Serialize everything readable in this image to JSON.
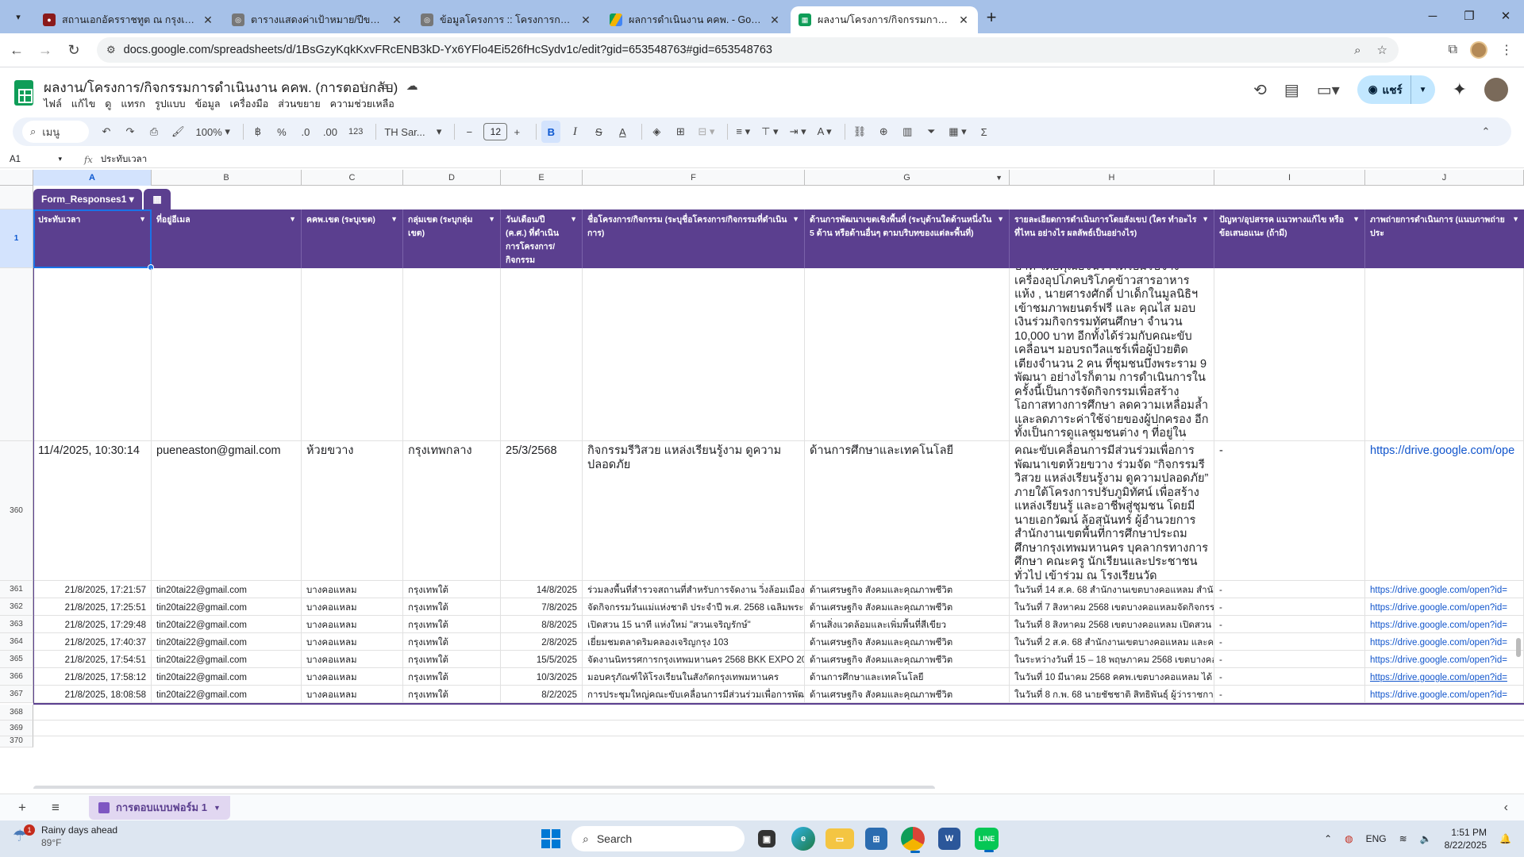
{
  "browser": {
    "tabs": [
      {
        "title": "สถานเอกอัครราชทูต ณ กรุงเบอร์ลิน",
        "icon_color": "#8b1a1a",
        "active": false
      },
      {
        "title": "ตารางแสดงค่าเป้าหมาย/ปีของ KEY_R",
        "icon_color": "#666666",
        "active": false
      },
      {
        "title": "ข้อมูลโครงการ :: โครงการการมีส่วนร่",
        "icon_color": "#666666",
        "active": false
      },
      {
        "title": "ผลการดำเนินงาน คคพ. - Google ไ",
        "icon_color": "#f4b400",
        "active": false
      },
      {
        "title": "ผลงาน/โครงการ/กิจกรรมการดำเนินง",
        "icon_color": "#0f9d58",
        "active": true
      }
    ],
    "url": "docs.google.com/spreadsheets/d/1BsGzyKqkKxvFRcENB3kD-Yx6YFlo4Ei526fHcSydv1c/edit?gid=653548763#gid=653548763"
  },
  "sheets": {
    "doc_title": "ผลงาน/โครงการ/กิจกรรมการดำเนินงาน คคพ. (การตอบกลับ)",
    "menu": [
      "ไฟล์",
      "แก้ไข",
      "ดู",
      "แทรก",
      "รูปแบบ",
      "ข้อมูล",
      "เครื่องมือ",
      "ส่วนขยาย",
      "ความช่วยเหลือ"
    ],
    "share_label": "แชร์",
    "toolbar": {
      "search_menu": "เมนู",
      "zoom": "100%",
      "currency": "฿",
      "percent": "%",
      "dec_dec": ".0",
      "dec_inc": ".00",
      "format_123": "123",
      "font": "TH Sar...",
      "font_size": "12"
    },
    "name_box": "A1",
    "formula": "ประทับเวลา",
    "columns": [
      "A",
      "B",
      "C",
      "D",
      "E",
      "F",
      "G",
      "H",
      "I",
      "J"
    ],
    "table_name": "Form_Responses1",
    "header_row_num": "1",
    "headers": [
      "ประทับเวลา",
      "ที่อยู่อีเมล",
      "คคพ.เขต (ระบุเขต)",
      "กลุ่มเขต (ระบุกลุ่มเขต)",
      "วัน/เดือน/ปี (ค.ศ.) ที่ดำเนินการโครงการ/กิจกรรม",
      "ชื่อโครงการ/กิจกรรม (ระบุชื่อโครงการ/กิจกรรมที่ดำเนินการ)",
      "ด้านการพัฒนาเขตเชิงพื้นที่ (ระบุด้านใดด้านหนึ่งใน 5 ด้าน หรือด้านอื่นๆ ตามบริบทของแต่ละพื้นที่)",
      "รายละเอียดการดำเนินการโดยสังเขป (ใคร ทำอะไร ที่ไหน อย่างไร ผลลัพธ์เป็นอย่างไร)",
      "ปัญหา/อุปสรรค แนวทางแก้ไข หรือข้อเสนอแนะ (ถ้ามี)",
      "ภาพถ่ายการดำเนินการ (แนบภาพถ่ายประ"
    ],
    "overflow_text": "บาท โดยคุณอัจฉรา เตรียมรับจ้างเครื่องอุปโภคบริโภคข้าวสารอาหารแห้ง , นายศารงศักดิ์ ปาเด็กในมูลนิธิฯเข้าชมภาพยนตร์ฟรี และ คุณไส มอบเงินร่วมกิจกรรมทัศนศึกษา จำนวน 10,000 บาท อีกทั้งได้ร่วมกับคณะขับเคลื่อนฯ มอบรถวีลแชร์เพื่อผู้ป่วยติดเตียงจำนวน 2 คน ที่ชุมชนบึงพระราม 9 พัฒนา อย่างไรก็ตาม การดำเนินการในครั้งนี้เป็นการจัดกิจกรรมเพื่อสร้างโอกาสทางการศึกษา ลดความเหลื่อมล้ำและลดภาระค่าใช้จ่ายของผู้ปกครอง อีกทั้งเป็นการดูแลชุมชนต่าง ๆ ที่อยู่ในบันทึกข้อตกลงที่จะร่วมกันพัฒนาเด็กและเยาวชนกับโรงเรียนวัดอุทัยธาราม",
    "row_360": {
      "num": "360",
      "cells": [
        "11/4/2025, 10:30:14",
        "pueneaston@gmail.com",
        "ห้วยขวาง",
        "กรุงเทพกลาง",
        "25/3/2568",
        "กิจกรรมรีวิสวย แหล่งเรียนรู้งาม ดูความปลอดภัย",
        "ด้านการศึกษาและเทคโนโลยี",
        "คณะขับเคลื่อนการมีส่วนร่วมเพื่อการพัฒนาเขตห้วยขวาง ร่วมจัด “กิจกรรมรีวิสวย แหล่งเรียนรู้งาม ดูความปลอดภัย” ภายใต้โครงการปรับภูมิทัศน์ เพื่อสร้างแหล่งเรียนรู้ และอาชีพสู่ชุมชน โดยมีนายเอกวัฒน์ ล้อสุนันทร์ ผู้อำนวยการสำนักงานเขตพื้นที่การศึกษาประถมศึกษากรุงเทพมหานคร บุคลากรทางการศึกษา คณะครู นักเรียนและประชาชนทั่วไป เข้าร่วม ณ โรงเรียนวัดอุทัยธาราม",
        "-",
        "https://drive.google.com/ope"
      ]
    },
    "rows": [
      {
        "num": "361",
        "cells": [
          "21/8/2025, 17:21:57",
          "tin20tai22@gmail.com",
          "บางคอแหลม",
          "กรุงเทพใต้",
          "14/8/2025",
          "ร่วมลงพื้นที่สำรวจสถานที่สำหรับการจัดงาน   วิ่งล้อมเมือง",
          "ด้านเศรษฐกิจ สังคมและคุณภาพชีวิต",
          "ในวันที่ 14 ส.ค. 68 สำนักงานเขตบางคอแหลม สำนัก",
          "-",
          "https://drive.google.com/open?id="
        ]
      },
      {
        "num": "362",
        "cells": [
          "21/8/2025, 17:25:51",
          "tin20tai22@gmail.com",
          "บางคอแหลม",
          "กรุงเทพใต้",
          "7/8/2025",
          "จัดกิจกรรมวันแม่แห่งชาติ ประจำปี พ.ศ. 2568 เฉลิมพระเกียรติ",
          "ด้านเศรษฐกิจ สังคมและคุณภาพชีวิต",
          "ในวันที่ 7 สิงหาคม 2568 เขตบางคอแหลมจัดกิจกรรม",
          "-",
          "https://drive.google.com/open?id="
        ]
      },
      {
        "num": "363",
        "cells": [
          "21/8/2025, 17:29:48",
          "tin20tai22@gmail.com",
          "บางคอแหลม",
          "กรุงเทพใต้",
          "8/8/2025",
          "เปิดสวน 15 นาที แห่งใหม่ \"สวนเจริญรักษ์\"",
          "ด้านสิ่งแวดล้อมและเพิ่มพื้นที่สีเขียว",
          "ในวันที่ 8 สิงหาคม 2568 เขตบางคอแหลม เปิดสวน",
          "-",
          "https://drive.google.com/open?id="
        ]
      },
      {
        "num": "364",
        "cells": [
          "21/8/2025, 17:40:37",
          "tin20tai22@gmail.com",
          "บางคอแหลม",
          "กรุงเทพใต้",
          "2/8/2025",
          "เยี่ยมชมตลาดริมคลองเจริญกรุง 103",
          "ด้านเศรษฐกิจ สังคมและคุณภาพชีวิต",
          "ในวันที่ 2 ส.ค. 68 สำนักงานเขตบางคอแหลม และคณะ",
          "-",
          "https://drive.google.com/open?id="
        ]
      },
      {
        "num": "365",
        "cells": [
          "21/8/2025, 17:54:51",
          "tin20tai22@gmail.com",
          "บางคอแหลม",
          "กรุงเทพใต้",
          "15/5/2025",
          "จัดงานนิทรรศการกรุงเทพมหานคร 2568 BKK EXPO 2025",
          "ด้านเศรษฐกิจ สังคมและคุณภาพชีวิต",
          "ในระหว่างวันที่ 15 – 18 พฤษภาคม 2568 เขตบางคอแหลม",
          "-",
          "https://drive.google.com/open?id="
        ]
      },
      {
        "num": "366",
        "cells": [
          "21/8/2025, 17:58:12",
          "tin20tai22@gmail.com",
          "บางคอแหลม",
          "กรุงเทพใต้",
          "10/3/2025",
          "มอบครุภัณฑ์ให้โรงเรียนในสังกัดกรุงเทพมหานคร",
          "ด้านการศึกษาและเทคโนโลยี",
          "ในวันที่ 10 มีนาคม 2568  คคพ.เขตบางคอแหลม ได้",
          "-",
          "https://drive.google.com/open?id="
        ]
      },
      {
        "num": "367",
        "cells": [
          "21/8/2025, 18:08:58",
          "tin20tai22@gmail.com",
          "บางคอแหลม",
          "กรุงเทพใต้",
          "8/2/2025",
          "การประชุมใหญ่คณะขับเคลื่อนการมีส่วนร่วมเพื่อการพัฒนา",
          "ด้านเศรษฐกิจ สังคมและคุณภาพชีวิต",
          "ในวันที่ 8 ก.พ. 68 นายชัชชาติ สิทธิพันธุ์ ผู้ว่าราชการ",
          "-",
          "https://drive.google.com/open?id="
        ]
      }
    ],
    "empty_rows": [
      "368",
      "369",
      "370"
    ],
    "sheet_tab": "การตอบแบบฟอร์ม 1"
  },
  "taskbar": {
    "weather_title": "Rainy days ahead",
    "weather_temp": "89°F",
    "weather_badge": "1",
    "search_label": "Search",
    "lang": "ENG",
    "time": "1:51 PM",
    "date": "8/22/2025"
  }
}
